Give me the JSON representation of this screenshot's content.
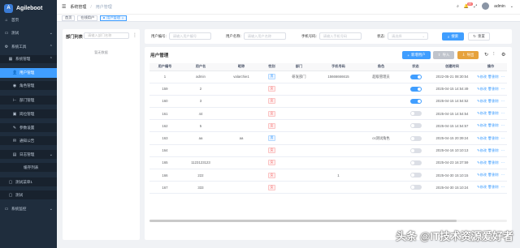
{
  "brand": {
    "name": "Agileboot",
    "logo_letter": "A"
  },
  "sidebar": {
    "items": [
      {
        "label": "首页",
        "icon": "home-icon",
        "glyph": "⌂"
      },
      {
        "label": "测试",
        "icon": "folder-icon",
        "glyph": "▭",
        "chevron": "⌄"
      },
      {
        "label": "系统工具",
        "icon": "setting-icon",
        "glyph": "⚙",
        "chevron": "⌃"
      },
      {
        "label": "系统管理",
        "icon": "system-icon",
        "glyph": "▦",
        "chevron": "⌃"
      },
      {
        "label": "用户管理",
        "icon": "user-icon",
        "glyph": "👤"
      },
      {
        "label": "角色管理",
        "icon": "role-icon",
        "glyph": "◉"
      },
      {
        "label": "部门管理",
        "icon": "tree-icon",
        "glyph": "⊢"
      },
      {
        "label": "岗位管理",
        "icon": "post-icon",
        "glyph": "▣"
      },
      {
        "label": "参数设置",
        "icon": "edit-icon",
        "glyph": "✎"
      },
      {
        "label": "通知公告",
        "icon": "message-icon",
        "glyph": "✉"
      },
      {
        "label": "日志管理",
        "icon": "log-icon",
        "glyph": "▤",
        "chevron": "⌄"
      },
      {
        "label": "缓存列表",
        "icon": "",
        "glyph": ""
      },
      {
        "label": "测试菜单1",
        "icon": "list-icon",
        "glyph": "▢"
      },
      {
        "label": "测试",
        "icon": "list-icon",
        "glyph": "▢"
      },
      {
        "label": "系统监控",
        "icon": "monitor-icon",
        "glyph": "▭",
        "chevron": "⌄"
      }
    ]
  },
  "header": {
    "breadcrumb": [
      "系统管理",
      "用户管理"
    ],
    "notification_count": "99",
    "username": "admin"
  },
  "tabs": [
    {
      "label": "首页",
      "active": false
    },
    {
      "label": "在线用户",
      "active": false
    },
    {
      "label": "用户管理",
      "active": true
    }
  ],
  "dept_panel": {
    "title": "部门列表",
    "search_placeholder": "请输入部门名称",
    "empty_text": "暂无数据"
  },
  "search_form": {
    "user_id_label": "用户编号:",
    "user_id_placeholder": "请输入用户编号",
    "username_label": "用户名称:",
    "username_placeholder": "请输入用户名称",
    "phone_label": "手机号码:",
    "phone_placeholder": "请输入手机号码",
    "status_label": "状态:",
    "status_placeholder": "请选择",
    "search_button": "搜索",
    "reset_button": "重置"
  },
  "table_panel": {
    "title": "用户管理",
    "add_button": "新增用户",
    "import_button": "导入",
    "export_button": "导出",
    "columns": [
      "用户编号",
      "用户名",
      "昵称",
      "性别",
      "部门",
      "手机号码",
      "角色",
      "状态",
      "创建时间",
      "操作"
    ],
    "edit_label": "修改",
    "delete_label": "删除",
    "rows": [
      {
        "id": "1",
        "username": "admin",
        "nickname": "valarchie1",
        "sex": "男",
        "dept": "研发部门",
        "phone": "15666666615",
        "role": "超级管理员",
        "enabled": true,
        "created": "2022-05-21 08:30:54"
      },
      {
        "id": "159",
        "username": "2",
        "nickname": "",
        "sex": "女",
        "dept": "",
        "phone": "",
        "role": "",
        "enabled": true,
        "created": "2025-04-15 14:54:49"
      },
      {
        "id": "160",
        "username": "3",
        "nickname": "",
        "sex": "女",
        "dept": "",
        "phone": "",
        "role": "",
        "enabled": true,
        "created": "2025-04-15 14:54:52"
      },
      {
        "id": "161",
        "username": "44",
        "nickname": "",
        "sex": "女",
        "dept": "",
        "phone": "",
        "role": "",
        "enabled": false,
        "created": "2025-04-15 14:54:54"
      },
      {
        "id": "162",
        "username": "5",
        "nickname": "",
        "sex": "女",
        "dept": "",
        "phone": "",
        "role": "",
        "enabled": false,
        "created": "2025-04-15 14:54:57"
      },
      {
        "id": "163",
        "username": "aa",
        "nickname": "aa",
        "sex": "男",
        "dept": "",
        "phone": "",
        "role": "cs测试角色",
        "enabled": false,
        "created": "2025-04-15 20:39:24"
      },
      {
        "id": "164",
        "username": "",
        "nickname": "",
        "sex": "女",
        "dept": "",
        "phone": "",
        "role": "",
        "enabled": false,
        "created": "2025-04-16 10:10:13"
      },
      {
        "id": "165",
        "username": "1123123123",
        "nickname": "",
        "sex": "女",
        "dept": "",
        "phone": "",
        "role": "",
        "enabled": false,
        "created": "2025-04-23 16:37:59"
      },
      {
        "id": "166",
        "username": "222",
        "nickname": "",
        "sex": "女",
        "dept": "",
        "phone": "1",
        "role": "",
        "enabled": false,
        "created": "2025-04-30 15:10:15"
      },
      {
        "id": "167",
        "username": "333",
        "nickname": "",
        "sex": "女",
        "dept": "",
        "phone": "",
        "role": "",
        "enabled": false,
        "created": "2025-04-30 15:10:24"
      }
    ]
  },
  "watermark": "头条 @IT技术资源爱好者",
  "colors": {
    "accent": "#409eff",
    "sidebar_bg": "#1f2d3d",
    "warning": "#e6a23c",
    "success": "#67c23a"
  }
}
